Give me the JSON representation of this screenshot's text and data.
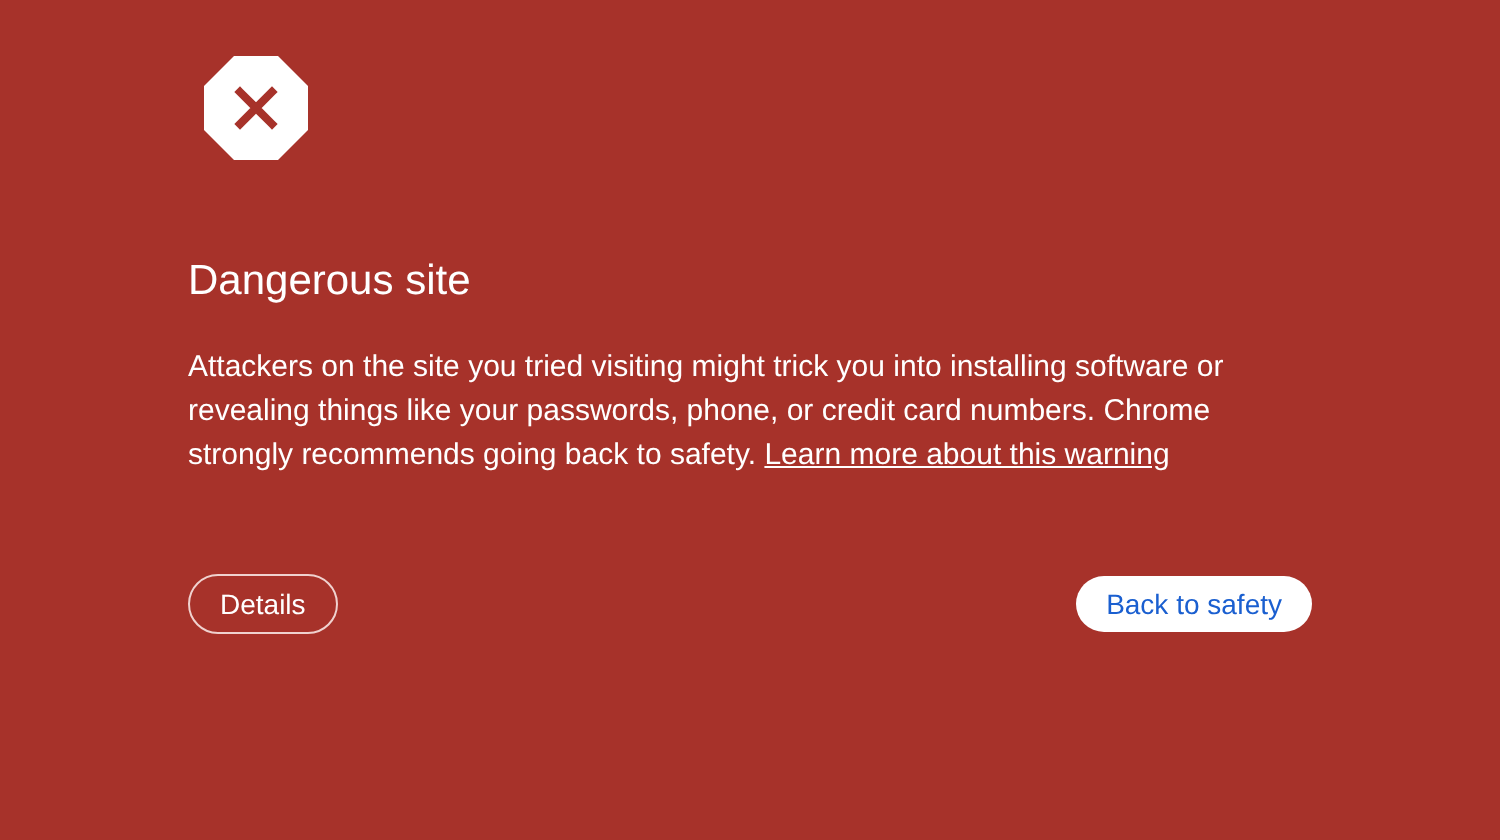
{
  "title": "Dangerous site",
  "message": "Attackers on the site you tried visiting might trick you into installing software or revealing things like your passwords, phone, or credit card numbers. Chrome strongly recommends going back to safety.",
  "learn_more_link": "Learn more about this warning",
  "buttons": [
    {
      "label": "Details",
      "kind": "outline"
    },
    {
      "label": "Back to safety",
      "kind": "primary"
    }
  ]
}
